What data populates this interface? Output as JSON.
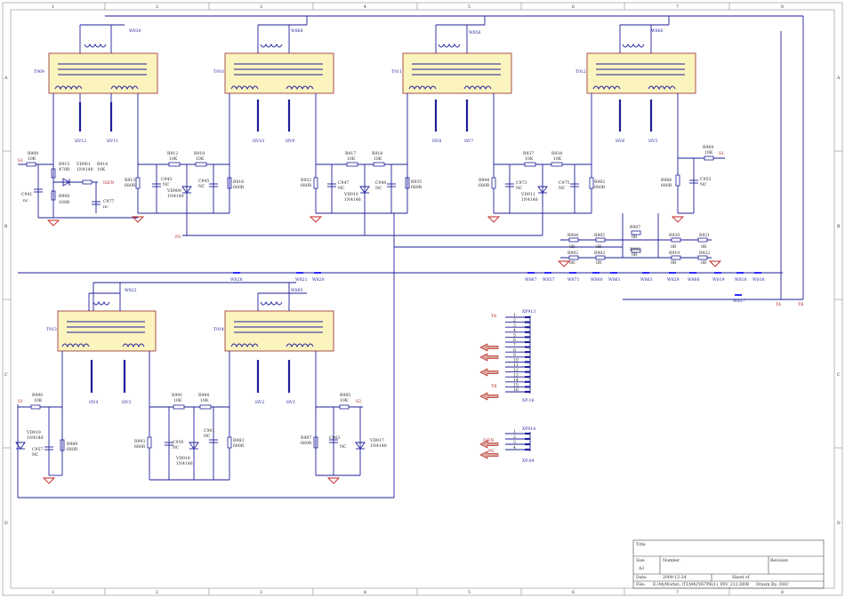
{
  "frame": {
    "columns": [
      "1",
      "2",
      "3",
      "4",
      "5",
      "6",
      "7",
      "8"
    ],
    "rows": [
      "A",
      "B",
      "C",
      "D"
    ]
  },
  "title_block": {
    "title_label": "Title",
    "size_label": "Size",
    "size_value": "A3",
    "number_label": "Number",
    "revision_label": "Revision",
    "date_label": "Date:",
    "date_value": "2009-12-24",
    "sheet_label": "Sheet    of",
    "file_label": "File:",
    "file_value": "E:\\MyWorks\\..\\TLM42V67PK(1)_INV_212.DDB",
    "drawn_label": "Drawn By: DOC"
  },
  "transformers": [
    {
      "ref": "T909",
      "jumper": "W830",
      "hv_left": "HV12",
      "hv_right": "HV11"
    },
    {
      "ref": "T910",
      "jumper": "W868",
      "hv_left": "HV10",
      "hv_right": "HV9"
    },
    {
      "ref": "T911",
      "jumper": "W856",
      "hv_left": "HV8",
      "hv_right": "HV7"
    },
    {
      "ref": "T912",
      "jumper": "W866",
      "hv_left": "HV6",
      "hv_right": "HV5"
    },
    {
      "ref": "T913",
      "jumper": "W822",
      "hv_left": "HV4",
      "hv_right": "HV3"
    },
    {
      "ref": "T914",
      "jumper": "W865",
      "hv_left": "HV2",
      "hv_right": "HV1"
    }
  ],
  "components": {
    "r909": [
      "R909",
      "10K"
    ],
    "r915": [
      "R915",
      "470R"
    ],
    "vd901": [
      "VD901",
      "1N4148"
    ],
    "r914": [
      "R914",
      "10K"
    ],
    "c941": [
      "C941",
      "nc"
    ],
    "r908": [
      "R908",
      "100R"
    ],
    "c977": [
      "C977",
      "nc"
    ],
    "r913": [
      "R913",
      "680R"
    ],
    "r912": [
      "R912",
      "10K"
    ],
    "r910": [
      "R910",
      "10K"
    ],
    "c943": [
      "C943",
      "NC"
    ],
    "vd909": [
      "VD909",
      "1N4148"
    ],
    "c945": [
      "C945",
      "NC"
    ],
    "r916": [
      "R916",
      "680R"
    ],
    "r932": [
      "R932",
      "680R"
    ],
    "r917": [
      "R917",
      "10K"
    ],
    "r918": [
      "R918",
      "10K"
    ],
    "c947": [
      "C947",
      "NC"
    ],
    "vd910": [
      "VD910",
      "1N4148"
    ],
    "c949": [
      "C949",
      "NC"
    ],
    "r935": [
      "R935",
      "680R"
    ],
    "r944": [
      "R944",
      "680R"
    ],
    "r937": [
      "R937",
      "10K"
    ],
    "r934": [
      "R934",
      "10K"
    ],
    "c973": [
      "C973",
      "NC"
    ],
    "vd911": [
      "VD911",
      "1N4148"
    ],
    "c975": [
      "C975",
      "NC"
    ],
    "r962": [
      "R962",
      "680R"
    ],
    "r964": [
      "R964",
      "10K"
    ],
    "r966": [
      "R966",
      "680R"
    ],
    "c955": [
      "C955",
      "NC"
    ],
    "r904": [
      "R904",
      "0R"
    ],
    "r905": [
      "R905",
      "0R"
    ],
    "r907": [
      "R907",
      "0R"
    ],
    "r920": [
      "R920",
      "0R"
    ],
    "r921": [
      "R921",
      "0R"
    ],
    "r902": [
      "R902",
      "0R"
    ],
    "r903": [
      "R903",
      "0R"
    ],
    "r906": [
      "R906",
      "0R"
    ],
    "r919": [
      "R919",
      "0R"
    ],
    "r922": [
      "R922",
      "0R"
    ],
    "r990": [
      "R990",
      "10K"
    ],
    "vd919": [
      "VD919",
      "1N4148"
    ],
    "c957": [
      "C957",
      "NC"
    ],
    "r989": [
      "R989",
      "680R"
    ],
    "r991": [
      "R991",
      "10K"
    ],
    "r984": [
      "R984",
      "10K"
    ],
    "r993": [
      "R993",
      "680R"
    ],
    "c959": [
      "C959",
      "NC"
    ],
    "vd918": [
      "VD918",
      "1N4148"
    ],
    "c961": [
      "C961",
      "NC"
    ],
    "r983": [
      "R983",
      "680R"
    ],
    "r985": [
      "R985",
      "10K"
    ],
    "r987": [
      "R987",
      "680R"
    ],
    "c963": [
      "C963",
      "NC"
    ],
    "vd917": [
      "VD917",
      "1N4148"
    ]
  },
  "jumpers": {
    "w828": "W828",
    "w821": "W821",
    "w820": "W820",
    "w867": "W867",
    "w857": "W857",
    "w871": "W871",
    "w860": "W860",
    "w861": "W861",
    "w863": "W863",
    "w829": "W829",
    "w866b": "W866",
    "w819": "W819",
    "w818": "W818",
    "w816": "W816",
    "w837": "W837"
  },
  "nets": {
    "s1_left": "S1",
    "s1_right": "S1",
    "isen": "ISEN",
    "ps": "PS",
    "ta": "TA",
    "tb": "TB",
    "s2_bot_left": "S1",
    "s2_bot_right": "S2"
  },
  "connectors": {
    "xp913_ref": "XP913",
    "xp913_type": "XP-16",
    "xp913_pins": [
      "1",
      "2",
      "3",
      "4",
      "5",
      "6",
      "7",
      "8",
      "9",
      "10",
      "11",
      "12",
      "13",
      "14",
      "15",
      "16"
    ],
    "xp914_ref": "XP914",
    "xp914_type": "XP-04",
    "xp914_pins": [
      "1",
      "2",
      "3",
      "4"
    ],
    "ta_label": "TA",
    "tb_label": "TB",
    "isen_label": "ISEN",
    "ps_label": "PS"
  }
}
